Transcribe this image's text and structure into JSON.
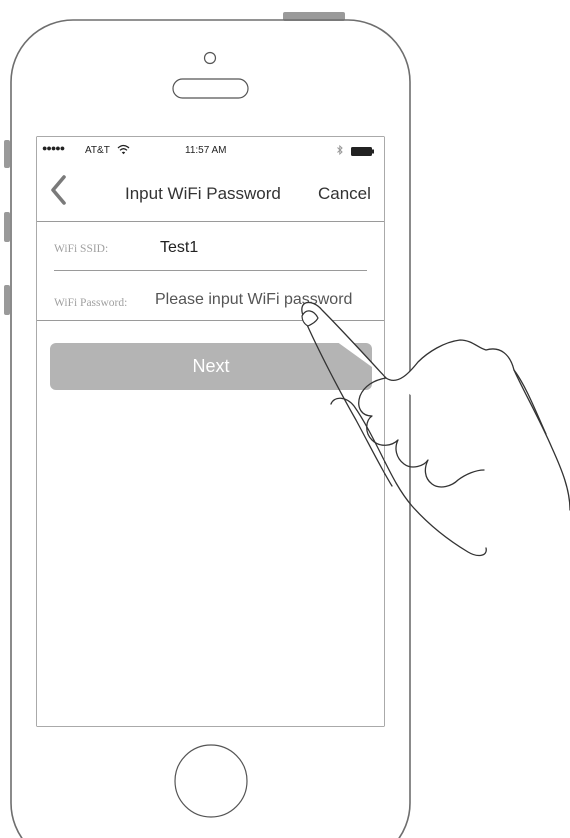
{
  "status_bar": {
    "signal": "●●●●●",
    "carrier": "AT&T",
    "time": "11:57 AM",
    "icons": [
      "wifi-icon",
      "bluetooth-icon",
      "battery-icon"
    ]
  },
  "nav": {
    "back_icon": "chevron-left-icon",
    "title": "Input WiFi Password",
    "cancel_label": "Cancel"
  },
  "form": {
    "ssid_label": "WiFi SSID:",
    "ssid_value": "Test1",
    "password_label": "WiFi Password:",
    "password_placeholder": "Please input WiFi password",
    "password_value": ""
  },
  "next_button": {
    "label": "Next",
    "color": "#b4b4b4"
  }
}
